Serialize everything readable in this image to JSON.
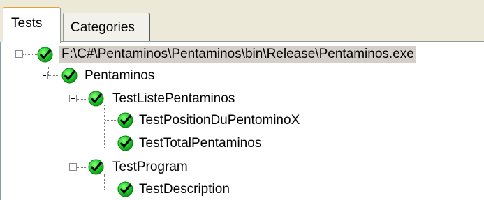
{
  "tabs": [
    {
      "label": "Tests",
      "active": true
    },
    {
      "label": "Categories",
      "active": false
    }
  ],
  "tree": {
    "root": {
      "label": "F:\\C#\\Pentaminos\\Pentaminos\\bin\\Release\\Pentaminos.exe",
      "status": "passed",
      "expanded": true,
      "selected": true
    },
    "namespace": {
      "label": "Pentaminos",
      "status": "passed",
      "expanded": true
    },
    "fixtures": [
      {
        "label": "TestListePentaminos",
        "status": "passed",
        "expanded": true,
        "tests": [
          {
            "label": "TestPositionDuPentominoX",
            "status": "passed"
          },
          {
            "label": "TestTotalPentaminos",
            "status": "passed"
          }
        ]
      },
      {
        "label": "TestProgram",
        "status": "passed",
        "expanded": true,
        "tests": [
          {
            "label": "TestDescription",
            "status": "passed"
          }
        ]
      }
    ]
  },
  "colors": {
    "passed_green": "#1fd12a",
    "check_black": "#000000",
    "selection_bg": "#d4d0c8",
    "tab_accent": "#e0a432"
  },
  "icons": {
    "expander": "minus-box-icon",
    "status": "green-check-icon"
  }
}
